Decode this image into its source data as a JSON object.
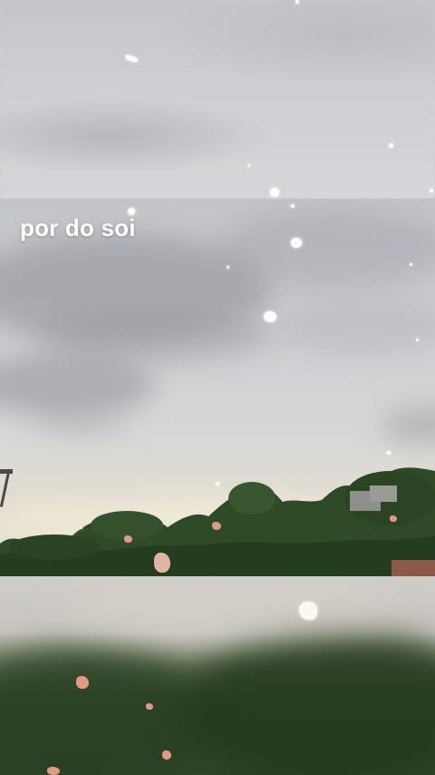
{
  "caption": {
    "text": "por do soi"
  },
  "colors": {
    "sky": "#cdced1",
    "horizon": "#e8e2d2",
    "foliage": "#2f4a26",
    "caption": "#ffffff",
    "petal": "#f2a48f"
  }
}
